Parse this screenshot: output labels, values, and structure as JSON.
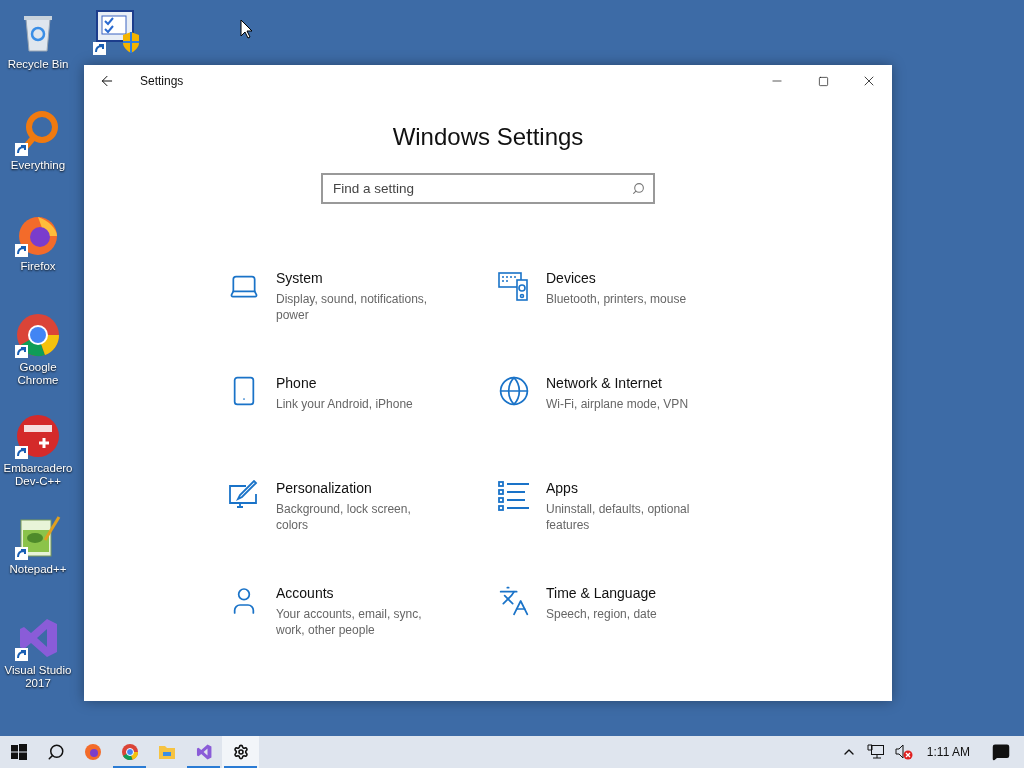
{
  "desktop_icons": [
    {
      "label": "Recycle Bin",
      "kind": "recycle"
    },
    {
      "label": "Everything",
      "kind": "everything",
      "shortcut": true
    },
    {
      "label": "Firefox",
      "kind": "firefox",
      "shortcut": true
    },
    {
      "label": "Google Chrome",
      "kind": "chrome",
      "shortcut": true
    },
    {
      "label": "Embarcadero Dev-C++",
      "kind": "devcpp",
      "shortcut": true
    },
    {
      "label": "Notepad++",
      "kind": "notepad",
      "shortcut": true
    },
    {
      "label": "Visual Studio 2017",
      "kind": "vs",
      "shortcut": true
    }
  ],
  "desktop_icons_column_2": [
    {
      "kind": "classic",
      "shortcut": true
    }
  ],
  "window": {
    "title": "Settings",
    "heading": "Windows Settings",
    "search": {
      "placeholder": "Find a setting"
    },
    "categories": [
      {
        "kind": "system",
        "title": "System",
        "description": "Display, sound, notifications, power"
      },
      {
        "kind": "devices",
        "title": "Devices",
        "description": "Bluetooth, printers, mouse"
      },
      {
        "kind": "phone",
        "title": "Phone",
        "description": "Link your Android, iPhone"
      },
      {
        "kind": "network",
        "title": "Network & Internet",
        "description": "Wi-Fi, airplane mode, VPN"
      },
      {
        "kind": "personalization",
        "title": "Personalization",
        "description": "Background, lock screen, colors"
      },
      {
        "kind": "apps",
        "title": "Apps",
        "description": "Uninstall, defaults, optional features"
      },
      {
        "kind": "accounts",
        "title": "Accounts",
        "description": "Your accounts, email, sync, work, other people"
      },
      {
        "kind": "time",
        "title": "Time & Language",
        "description": "Speech, region, date"
      }
    ]
  },
  "taskbar": {
    "items": [
      {
        "kind": "start",
        "selected": false
      },
      {
        "kind": "search",
        "selected": false
      },
      {
        "kind": "firefox",
        "selected": false
      },
      {
        "kind": "chrome",
        "running": true,
        "selected": false
      },
      {
        "kind": "explorer",
        "selected": false
      },
      {
        "kind": "vs",
        "running": true,
        "selected": false
      },
      {
        "kind": "settings",
        "running": true,
        "selected": true
      }
    ],
    "clock": "1:11 AM"
  }
}
